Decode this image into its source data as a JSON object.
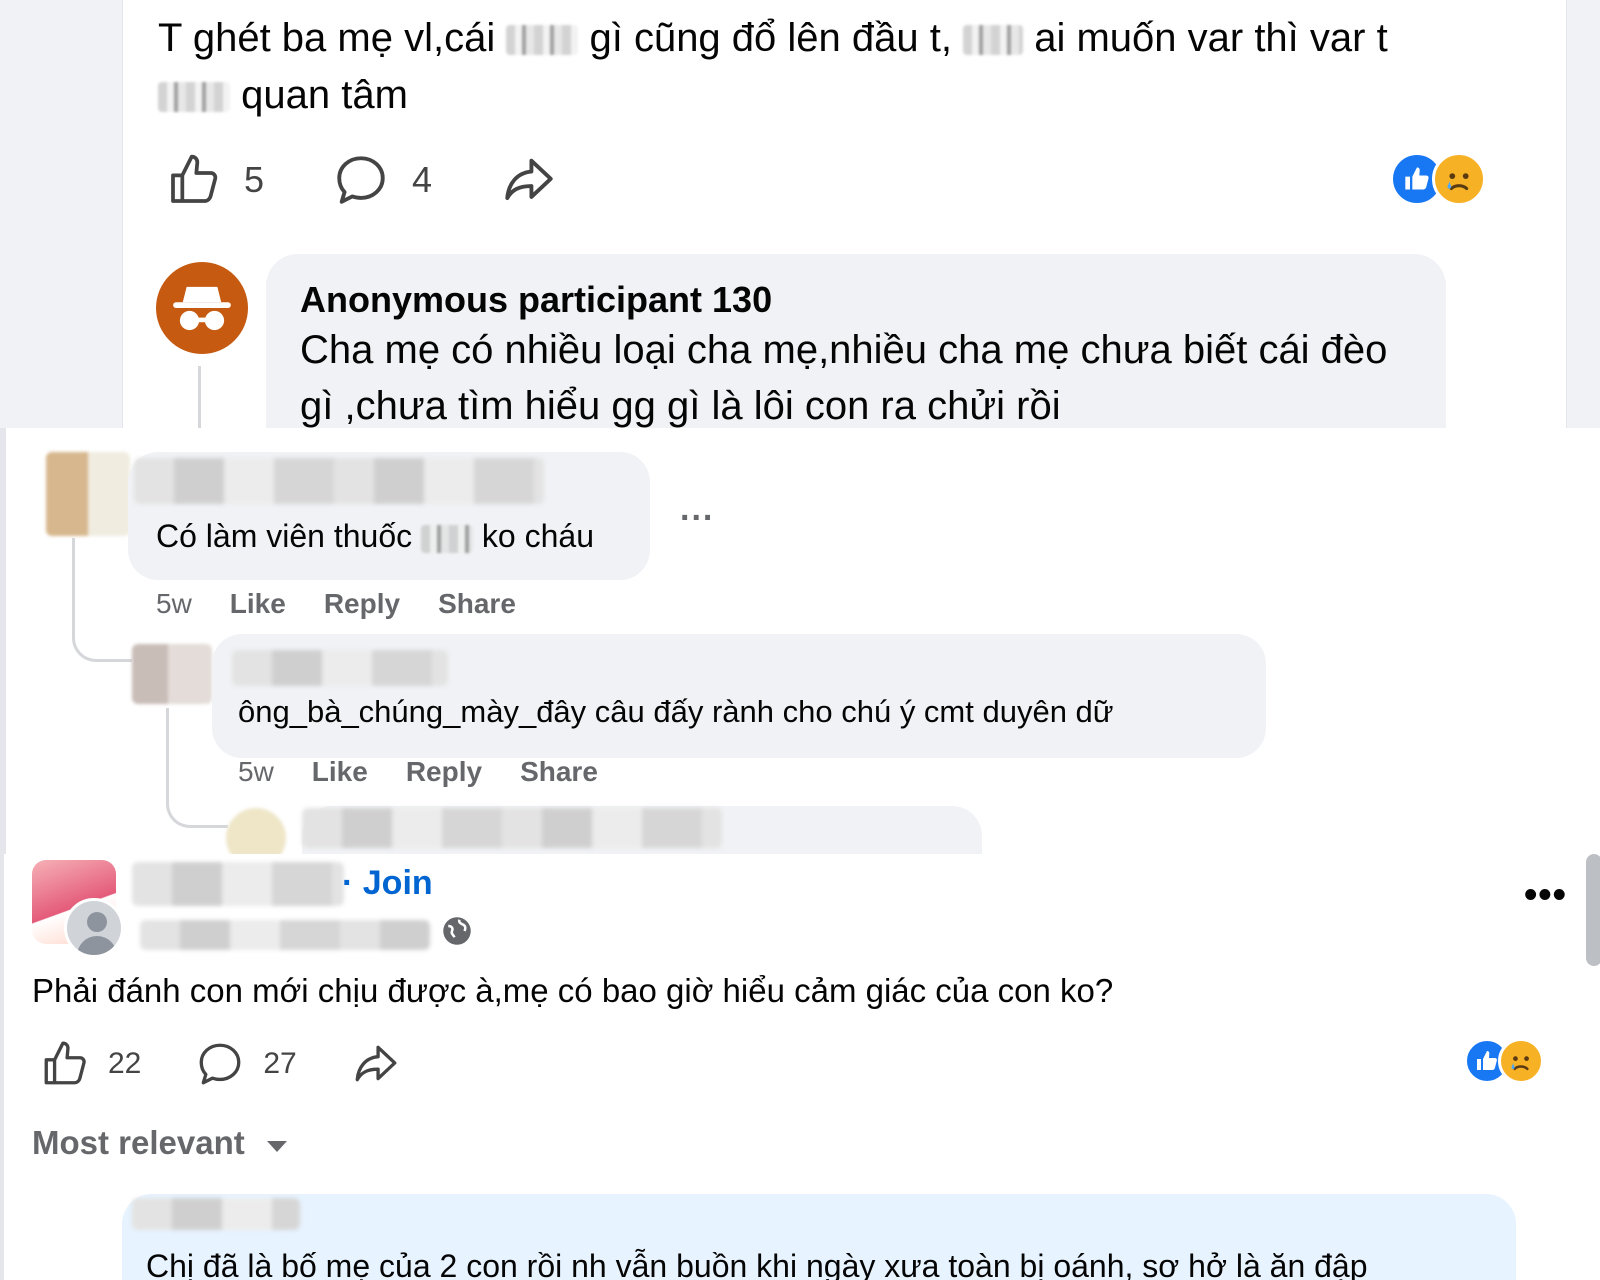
{
  "post1": {
    "text_a": "T ghét ba mẹ vl,cái",
    "text_b": "gì cũng đổ lên đầu t,",
    "text_c": "ai muốn var thì var t",
    "text_d": "quan tâm",
    "like_count": "5",
    "comment_count": "4"
  },
  "anon_comment": {
    "name": "Anonymous participant 130",
    "text": "Cha mẹ có nhiều loại cha mẹ,nhiều cha mẹ chưa biết cái đèo gì ,chưa tìm hiểu gg gì là lôi con ra chửi rồi"
  },
  "comment1": {
    "text_a": "Có làm viên thuốc",
    "text_b": "ko cháu",
    "more": "...",
    "time": "5w",
    "like": "Like",
    "reply": "Reply",
    "share": "Share"
  },
  "comment2": {
    "text": "ông_bà_chúng_mày_đây câu đấy rành cho chú ý cmt duyên dữ",
    "time": "5w",
    "like": "Like",
    "reply": "Reply",
    "share": "Share"
  },
  "post2": {
    "join": "· Join",
    "more": "•••",
    "text": "Phải đánh con mới chịu được à,mẹ có bao giờ hiểu cảm giác của con ko?",
    "like_count": "22",
    "comment_count": "27",
    "sort_label": "Most relevant",
    "reply_preview": "Chị đã là bố mẹ của 2 con rồi nh vẫn buồn khi ngày xưa toàn bị oánh, sơ hở là ăn đập"
  },
  "colors": {
    "link": "#0064d1",
    "like_blue": "#1877f2",
    "anon_avatar": "#c65a11",
    "bubble": "#f0f2f5",
    "highlight_bubble": "#e7f3ff"
  }
}
